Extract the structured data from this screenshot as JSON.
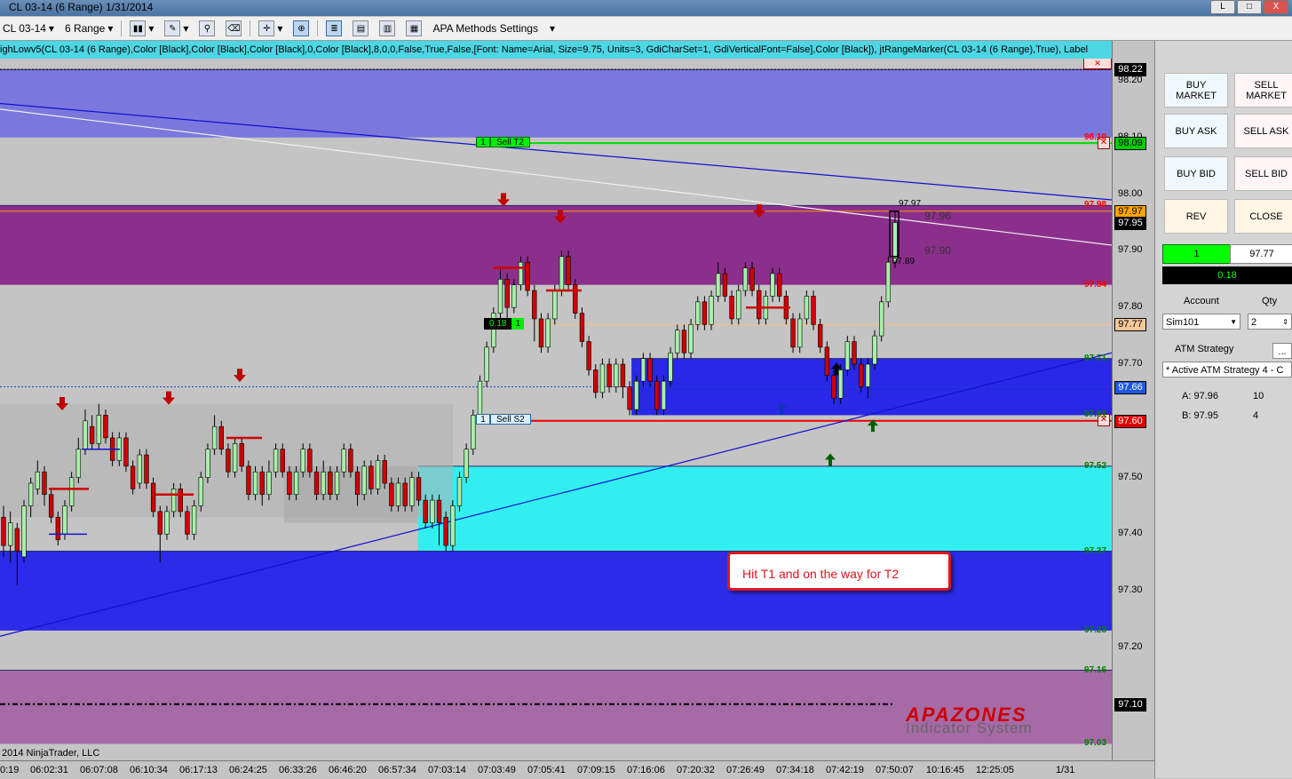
{
  "window": {
    "title": "CL 03-14 (6 Range)  1/31/2014",
    "btn_min": "L",
    "btn_max": "□",
    "btn_close": "X"
  },
  "toolbar": {
    "instrument": "CL 03-14",
    "period": "6 Range",
    "strategy_settings": "APA Methods Settings",
    "icons": [
      "bar-style-icon",
      "draw-pencil-icon",
      "pin-icon",
      "eraser-icon",
      "crosshair-icon",
      "zoom-icon",
      "properties-icon",
      "order-entry-icon",
      "chart-trader-icon",
      "data-box-icon"
    ]
  },
  "indicator_line": "ighLowv5(CL 03-14 (6 Range),Color [Black],Color [Black],Color [Black],0,Color [Black],8,0,0,False,True,False,[Font: Name=Arial, Size=9.75, Units=3, GdiCharSet=1, GdiVerticalFont=False],Color [Black]), jtRangeMarker(CL 03-14 (6 Range),True), Label",
  "chart": {
    "copyright": "2014 NinjaTrader, LLC",
    "annotation": "Hit T1 and on the way for T2",
    "watermark_top": "APAZONES",
    "watermark_bottom": "Indicator System",
    "orders": [
      {
        "qty": "1",
        "label": "Sell T2",
        "price": 98.09
      },
      {
        "qty": "1",
        "label": "Sell S2",
        "price": 97.6
      }
    ],
    "pnl_tag": "0.18",
    "pnl_qty": "1",
    "price_labels": {
      "hi": "97.97",
      "mid1": "97.96",
      "mid2": "97.90",
      "lo": "97.89"
    },
    "zone_prices": [
      {
        "price": "98.10",
        "color": "#ff0000",
        "y": 98.1
      },
      {
        "price": "97.98",
        "color": "#ff0000",
        "y": 97.98
      },
      {
        "price": "97.84",
        "color": "#ff0000",
        "y": 97.84
      },
      {
        "price": "97.71",
        "color": "#008000",
        "y": 97.71
      },
      {
        "price": "97.61",
        "color": "#008000",
        "y": 97.61
      },
      {
        "price": "97.52",
        "color": "#008000",
        "y": 97.52
      },
      {
        "price": "97.37",
        "color": "#008000",
        "y": 97.37
      },
      {
        "price": "97.23",
        "color": "#008000",
        "y": 97.23
      },
      {
        "price": "97.16",
        "color": "#008000",
        "y": 97.16
      },
      {
        "price": "97.03",
        "color": "#008000",
        "y": 97.03
      }
    ]
  },
  "chart_data": {
    "type": "candlestick",
    "ylim": [
      97.0,
      98.27
    ],
    "yticks": [
      "98.20",
      "98.10",
      "98.00",
      "97.90",
      "97.80",
      "97.70",
      "97.60",
      "97.50",
      "97.40",
      "97.30",
      "97.20",
      "97.10"
    ],
    "xticks": [
      "0:19",
      "06:02:31",
      "06:07:08",
      "06:10:34",
      "06:17:13",
      "06:24:25",
      "06:33:26",
      "06:46:20",
      "06:57:34",
      "07:03:14",
      "07:03:49",
      "07:05:41",
      "07:09:15",
      "07:16:06",
      "07:20:32",
      "07:26:49",
      "07:34:18",
      "07:42:19",
      "07:50:07",
      "10:16:45",
      "12:25:05",
      "1/31"
    ],
    "axis_tags": [
      {
        "price": "98.22",
        "value": 98.22,
        "bg": "#000000",
        "fg": "#ffffff"
      },
      {
        "price": "98.09",
        "value": 98.09,
        "bg": "#00cc00",
        "fg": "#000000"
      },
      {
        "price": "97.97",
        "value": 97.97,
        "bg": "#ffa500",
        "fg": "#000000"
      },
      {
        "price": "97.95",
        "value": 97.95,
        "bg": "#000000",
        "fg": "#ffffff"
      },
      {
        "price": "97.77",
        "value": 97.77,
        "bg": "#f5c89a",
        "fg": "#000000"
      },
      {
        "price": "97.66",
        "value": 97.66,
        "bg": "#1e5adc",
        "fg": "#ffffff"
      },
      {
        "price": "97.60",
        "value": 97.6,
        "bg": "#e00000",
        "fg": "#ffffff"
      },
      {
        "price": "97.10",
        "value": 97.1,
        "bg": "#000000",
        "fg": "#ffffff"
      }
    ],
    "zones": [
      {
        "top": 98.22,
        "bottom": 98.1,
        "color": "#7b78dd"
      },
      {
        "top": 97.98,
        "bottom": 97.84,
        "color": "#8c2f8c"
      },
      {
        "top": 97.71,
        "bottom": 97.61,
        "color": "#2828e6",
        "x_start": 0.568
      },
      {
        "top": 97.52,
        "bottom": 97.37,
        "color": "#33eef0",
        "x_start": 0.376
      },
      {
        "top": 97.37,
        "bottom": 97.23,
        "color": "#2b2be8"
      },
      {
        "top": 97.16,
        "bottom": 97.03,
        "color": "#a66aa6"
      }
    ],
    "candles": [
      [
        97.43,
        97.38,
        97.45,
        97.36
      ],
      [
        97.38,
        97.42,
        97.44,
        97.35
      ],
      [
        97.41,
        97.37,
        97.42,
        97.31
      ],
      [
        97.36,
        97.45,
        97.46,
        97.35
      ],
      [
        97.45,
        97.49,
        97.5,
        97.43
      ],
      [
        97.48,
        97.51,
        97.53,
        97.47
      ],
      [
        97.51,
        97.47,
        97.52,
        97.45
      ],
      [
        97.47,
        97.43,
        97.48,
        97.42
      ],
      [
        97.43,
        97.39,
        97.44,
        97.38
      ],
      [
        97.4,
        97.45,
        97.46,
        97.39
      ],
      [
        97.45,
        97.5,
        97.51,
        97.44
      ],
      [
        97.5,
        97.55,
        97.57,
        97.49
      ],
      [
        97.55,
        97.6,
        97.62,
        97.54
      ],
      [
        97.59,
        97.56,
        97.61,
        97.55
      ],
      [
        97.56,
        97.61,
        97.63,
        97.55
      ],
      [
        97.61,
        97.57,
        97.62,
        97.56
      ],
      [
        97.57,
        97.53,
        97.58,
        97.52
      ],
      [
        97.53,
        97.57,
        97.58,
        97.52
      ],
      [
        97.57,
        97.52,
        97.58,
        97.51
      ],
      [
        97.52,
        97.48,
        97.53,
        97.47
      ],
      [
        97.49,
        97.54,
        97.55,
        97.48
      ],
      [
        97.54,
        97.49,
        97.55,
        97.48
      ],
      [
        97.49,
        97.44,
        97.5,
        97.43
      ],
      [
        97.44,
        97.4,
        97.45,
        97.35
      ],
      [
        97.4,
        97.44,
        97.45,
        97.39
      ],
      [
        97.44,
        97.48,
        97.49,
        97.43
      ],
      [
        97.48,
        97.44,
        97.49,
        97.43
      ],
      [
        97.44,
        97.4,
        97.45,
        97.39
      ],
      [
        97.4,
        97.45,
        97.46,
        97.39
      ],
      [
        97.45,
        97.5,
        97.51,
        97.44
      ],
      [
        97.5,
        97.55,
        97.56,
        97.49
      ],
      [
        97.55,
        97.59,
        97.61,
        97.54
      ],
      [
        97.59,
        97.55,
        97.6,
        97.54
      ],
      [
        97.55,
        97.51,
        97.56,
        97.5
      ],
      [
        97.51,
        97.56,
        97.57,
        97.5
      ],
      [
        97.56,
        97.52,
        97.57,
        97.51
      ],
      [
        97.52,
        97.47,
        97.53,
        97.46
      ],
      [
        97.47,
        97.51,
        97.52,
        97.46
      ],
      [
        97.51,
        97.47,
        97.52,
        97.45
      ],
      [
        97.47,
        97.51,
        97.53,
        97.46
      ],
      [
        97.51,
        97.55,
        97.56,
        97.5
      ],
      [
        97.55,
        97.51,
        97.56,
        97.5
      ],
      [
        97.51,
        97.47,
        97.52,
        97.46
      ],
      [
        97.47,
        97.51,
        97.52,
        97.46
      ],
      [
        97.51,
        97.55,
        97.56,
        97.5
      ],
      [
        97.55,
        97.51,
        97.56,
        97.5
      ],
      [
        97.51,
        97.47,
        97.52,
        97.46
      ],
      [
        97.47,
        97.51,
        97.53,
        97.46
      ],
      [
        97.51,
        97.47,
        97.52,
        97.46
      ],
      [
        97.47,
        97.51,
        97.52,
        97.46
      ],
      [
        97.51,
        97.55,
        97.56,
        97.5
      ],
      [
        97.55,
        97.51,
        97.56,
        97.5
      ],
      [
        97.51,
        97.47,
        97.52,
        97.45
      ],
      [
        97.47,
        97.52,
        97.53,
        97.46
      ],
      [
        97.52,
        97.48,
        97.53,
        97.47
      ],
      [
        97.48,
        97.53,
        97.54,
        97.47
      ],
      [
        97.53,
        97.49,
        97.54,
        97.48
      ],
      [
        97.49,
        97.45,
        97.5,
        97.44
      ],
      [
        97.45,
        97.49,
        97.5,
        97.44
      ],
      [
        97.49,
        97.45,
        97.5,
        97.44
      ],
      [
        97.45,
        97.5,
        97.51,
        97.44
      ],
      [
        97.5,
        97.46,
        97.51,
        97.45
      ],
      [
        97.46,
        97.42,
        97.47,
        97.41
      ],
      [
        97.42,
        97.46,
        97.47,
        97.41
      ],
      [
        97.46,
        97.42,
        97.47,
        97.38
      ],
      [
        97.43,
        97.38,
        97.44,
        97.37
      ],
      [
        97.38,
        97.45,
        97.46,
        97.37
      ],
      [
        97.45,
        97.5,
        97.51,
        97.44
      ],
      [
        97.5,
        97.55,
        97.56,
        97.49
      ],
      [
        97.55,
        97.61,
        97.62,
        97.54
      ],
      [
        97.61,
        97.67,
        97.68,
        97.6
      ],
      [
        97.67,
        97.73,
        97.74,
        97.66
      ],
      [
        97.73,
        97.79,
        97.8,
        97.72
      ],
      [
        97.79,
        97.85,
        97.87,
        97.78
      ],
      [
        97.85,
        97.8,
        97.86,
        97.78
      ],
      [
        97.8,
        97.84,
        97.85,
        97.79
      ],
      [
        97.84,
        97.88,
        97.89,
        97.83
      ],
      [
        97.88,
        97.83,
        97.89,
        97.82
      ],
      [
        97.83,
        97.78,
        97.84,
        97.74
      ],
      [
        97.78,
        97.73,
        97.79,
        97.72
      ],
      [
        97.73,
        97.78,
        97.79,
        97.72
      ],
      [
        97.78,
        97.83,
        97.84,
        97.77
      ],
      [
        97.83,
        97.89,
        97.9,
        97.82
      ],
      [
        97.89,
        97.84,
        97.9,
        97.83
      ],
      [
        97.84,
        97.79,
        97.85,
        97.78
      ],
      [
        97.79,
        97.74,
        97.8,
        97.73
      ],
      [
        97.74,
        97.69,
        97.75,
        97.68
      ],
      [
        97.69,
        97.65,
        97.7,
        97.64
      ],
      [
        97.65,
        97.7,
        97.71,
        97.64
      ],
      [
        97.7,
        97.66,
        97.71,
        97.65
      ],
      [
        97.66,
        97.7,
        97.71,
        97.65
      ],
      [
        97.7,
        97.66,
        97.71,
        97.64
      ],
      [
        97.66,
        97.62,
        97.67,
        97.61
      ],
      [
        97.62,
        97.67,
        97.68,
        97.61
      ],
      [
        97.67,
        97.71,
        97.72,
        97.66
      ],
      [
        97.71,
        97.67,
        97.72,
        97.66
      ],
      [
        97.67,
        97.62,
        97.68,
        97.61
      ],
      [
        97.62,
        97.67,
        97.68,
        97.61
      ],
      [
        97.67,
        97.72,
        97.73,
        97.66
      ],
      [
        97.72,
        97.76,
        97.77,
        97.71
      ],
      [
        97.76,
        97.72,
        97.77,
        97.71
      ],
      [
        97.72,
        97.77,
        97.78,
        97.71
      ],
      [
        97.77,
        97.81,
        97.82,
        97.76
      ],
      [
        97.81,
        97.77,
        97.82,
        97.76
      ],
      [
        97.77,
        97.82,
        97.83,
        97.76
      ],
      [
        97.82,
        97.86,
        97.88,
        97.81
      ],
      [
        97.86,
        97.82,
        97.87,
        97.81
      ],
      [
        97.82,
        97.78,
        97.83,
        97.77
      ],
      [
        97.78,
        97.83,
        97.84,
        97.77
      ],
      [
        97.83,
        97.87,
        97.88,
        97.82
      ],
      [
        97.87,
        97.83,
        97.88,
        97.82
      ],
      [
        97.83,
        97.78,
        97.84,
        97.77
      ],
      [
        97.78,
        97.82,
        97.83,
        97.77
      ],
      [
        97.82,
        97.86,
        97.87,
        97.81
      ],
      [
        97.86,
        97.82,
        97.87,
        97.81
      ],
      [
        97.82,
        97.78,
        97.83,
        97.77
      ],
      [
        97.78,
        97.73,
        97.79,
        97.72
      ],
      [
        97.73,
        97.78,
        97.79,
        97.72
      ],
      [
        97.78,
        97.82,
        97.83,
        97.77
      ],
      [
        97.82,
        97.77,
        97.83,
        97.76
      ],
      [
        97.77,
        97.73,
        97.78,
        97.72
      ],
      [
        97.73,
        97.68,
        97.74,
        97.67
      ],
      [
        97.68,
        97.64,
        97.69,
        97.63
      ],
      [
        97.64,
        97.69,
        97.7,
        97.63
      ],
      [
        97.69,
        97.74,
        97.75,
        97.68
      ],
      [
        97.74,
        97.7,
        97.75,
        97.69
      ],
      [
        97.7,
        97.66,
        97.71,
        97.65
      ],
      [
        97.66,
        97.7,
        97.71,
        97.64
      ],
      [
        97.7,
        97.75,
        97.76,
        97.69
      ],
      [
        97.75,
        97.81,
        97.82,
        97.74
      ],
      [
        97.81,
        97.88,
        97.89,
        97.8
      ],
      [
        97.88,
        97.95,
        97.97,
        97.87
      ]
    ]
  },
  "panel": {
    "buy_market": "BUY\nMARKET",
    "sell_market": "SELL\nMARKET",
    "buy_ask": "BUY ASK",
    "sell_ask": "SELL ASK",
    "buy_bid": "BUY BID",
    "sell_bid": "SELL BID",
    "rev": "REV",
    "close": "CLOSE",
    "position_qty": "1",
    "position_price": "97.77",
    "pnl": "0.18",
    "account_label": "Account",
    "qty_label": "Qty",
    "account_value": "Sim101",
    "qty_value": "2",
    "atm_label": "ATM Strategy",
    "atm_btn": "...",
    "atm_value": "* Active ATM Strategy 4 - C",
    "ask_label": "A: 97.96",
    "ask_size": "10",
    "bid_label": "B: 97.95",
    "bid_size": "4",
    "colors": {
      "long": "#00ff00",
      "pnl_bg": "#000000",
      "pnl_fg": "#00ff00"
    }
  }
}
